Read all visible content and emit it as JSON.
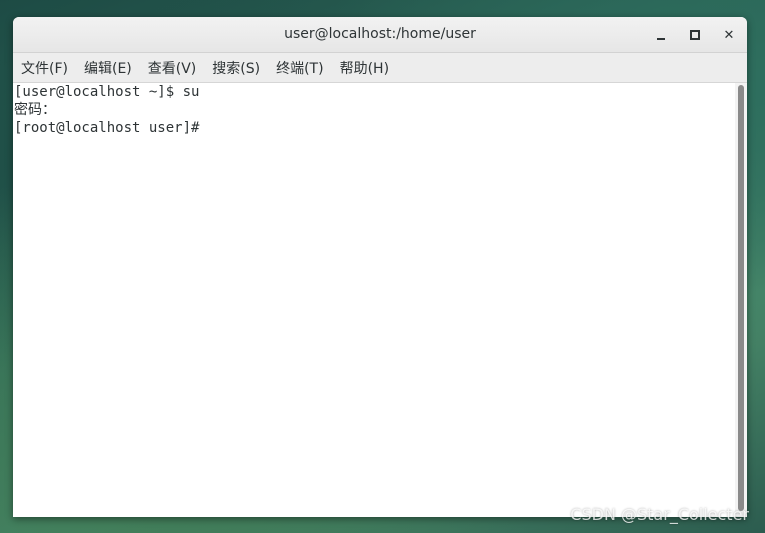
{
  "window": {
    "title": "user@localhost:/home/user",
    "controls": {
      "minimize_icon": "minimize-icon",
      "maximize_icon": "maximize-icon",
      "close_icon": "close-icon",
      "close_glyph": "✕"
    }
  },
  "menubar": {
    "items": [
      {
        "label": "文件(F)"
      },
      {
        "label": "编辑(E)"
      },
      {
        "label": "查看(V)"
      },
      {
        "label": "搜索(S)"
      },
      {
        "label": "终端(T)"
      },
      {
        "label": "帮助(H)"
      }
    ]
  },
  "terminal": {
    "lines": [
      "[user@localhost ~]$ su",
      "密码：",
      "[root@localhost user]# "
    ]
  },
  "watermark": {
    "text": "CSDN @Star_Collecter"
  }
}
